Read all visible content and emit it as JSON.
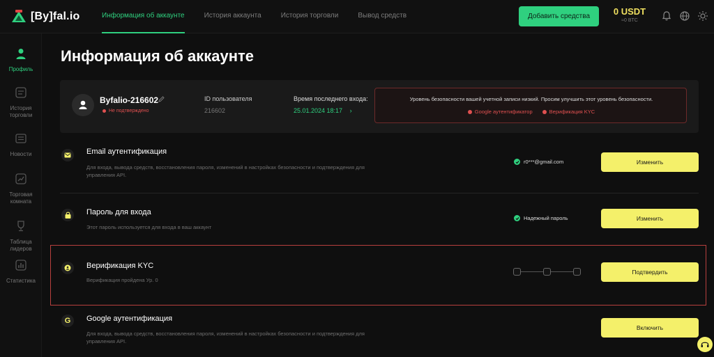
{
  "brand": {
    "logo_text": "[By]fal.io"
  },
  "nav": {
    "items": [
      {
        "label": "Информация об аккаунте",
        "active": true
      },
      {
        "label": "История аккаунта",
        "active": false
      },
      {
        "label": "История торговли",
        "active": false
      },
      {
        "label": "Вывод средств",
        "active": false
      }
    ]
  },
  "header": {
    "add_funds_label": "Добавить средства",
    "balance": "0 USDT",
    "balance_sub": "≈0 BTC",
    "icons": [
      "bell-icon",
      "globe-icon",
      "sun-icon"
    ]
  },
  "sidebar": {
    "items": [
      {
        "label": "Профиль",
        "icon": "user-icon",
        "active": true
      },
      {
        "label": "История торговли",
        "icon": "history-icon",
        "active": false
      },
      {
        "label": "Новости",
        "icon": "news-icon",
        "active": false
      },
      {
        "label": "Торговая комната",
        "icon": "chart-icon",
        "active": false
      },
      {
        "label": "Таблица лидеров",
        "icon": "trophy-icon",
        "active": false
      },
      {
        "label": "Статистика",
        "icon": "stats-icon",
        "active": false
      }
    ]
  },
  "page": {
    "title": "Информация об аккаунте"
  },
  "profile": {
    "username": "Byfalio-216602",
    "status": "Не подтверждено",
    "uid_label": "ID пользователя",
    "uid_value": "216602",
    "last_login_label": "Время последнего входа:",
    "last_login_value": "25.01.2024 18:17"
  },
  "security_warning": {
    "text": "Уровень безопасности вашей учетной записи низкий. Просим улучшить этот уровень безопасности.",
    "links": [
      "Google аутентификатор",
      "Верификация KYC"
    ]
  },
  "security": {
    "email": {
      "title": "Email аутентификация",
      "desc": "Для входа, вывода средств, восстановления пароля, изменений в настройках безопасности и подтверждения для управления API.",
      "status": "r0***@gmail.com",
      "button": "Изменить"
    },
    "password": {
      "title": "Пароль для входа",
      "desc": "Этот пароль используется для входа в ваш аккаунт",
      "status": "Надежный пароль",
      "button": "Изменить"
    },
    "kyc": {
      "title": "Верификация KYC",
      "desc": "Верификация пройдена Ур. 0",
      "steps_completed": 0,
      "steps_total": 3,
      "button": "Подтвердить"
    },
    "google": {
      "title": "Google аутентификация",
      "desc": "Для входа, вывода средств, восстановления пароля, изменений в настройках безопасности и подтверждения для управления API.",
      "button": "Включить"
    }
  },
  "colors": {
    "accent_green": "#2fd07f",
    "accent_yellow": "#f4f06a",
    "balance_yellow": "#f0e060",
    "danger": "#e05050",
    "background": "#0f0f0f"
  }
}
